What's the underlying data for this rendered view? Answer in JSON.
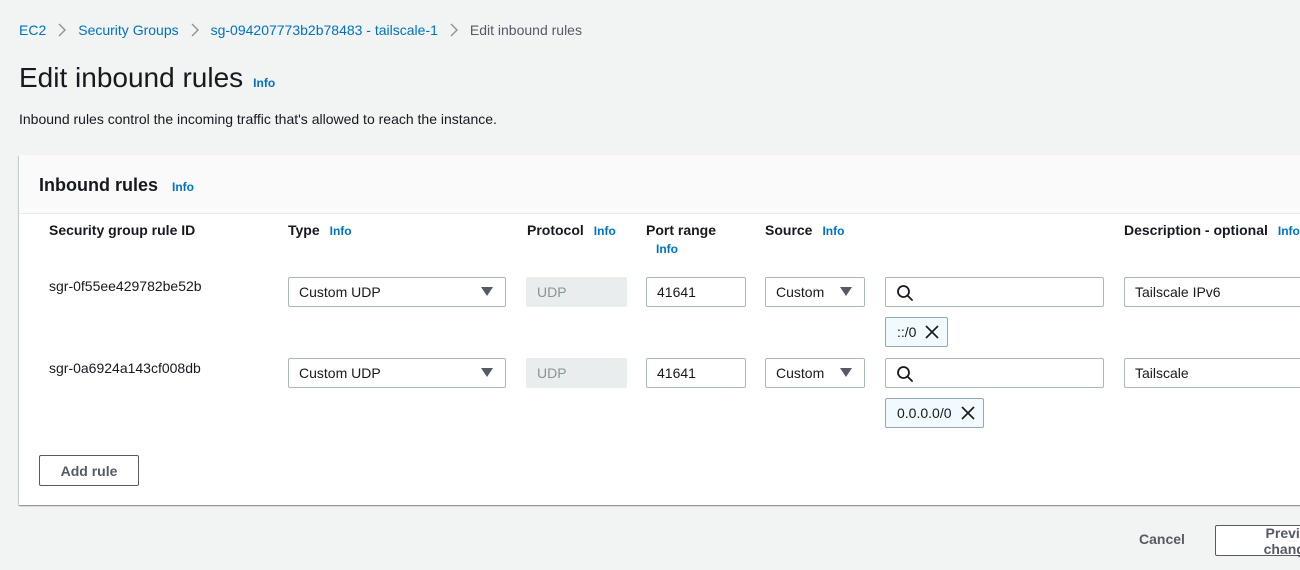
{
  "breadcrumb": {
    "items": [
      {
        "label": "EC2"
      },
      {
        "label": "Security Groups"
      },
      {
        "label": "sg-094207773b2b78483 - tailscale-1"
      },
      {
        "label": "Edit inbound rules"
      }
    ]
  },
  "page": {
    "title": "Edit inbound rules",
    "info": "Info",
    "description": "Inbound rules control the incoming traffic that's allowed to reach the instance."
  },
  "panel": {
    "title": "Inbound rules",
    "info": "Info",
    "columns": {
      "rule_id": "Security group rule ID",
      "type": "Type",
      "protocol": "Protocol",
      "port_range": "Port range",
      "source": "Source",
      "description": "Description - optional",
      "info": "Info"
    },
    "rules": [
      {
        "rule_id": "sgr-0f55ee429782be52b",
        "type": "Custom UDP",
        "protocol": "UDP",
        "port_range": "41641",
        "source_type": "Custom",
        "source_search": "",
        "source_token": "::/0",
        "description": "Tailscale IPv6"
      },
      {
        "rule_id": "sgr-0a6924a143cf008db",
        "type": "Custom UDP",
        "protocol": "UDP",
        "port_range": "41641",
        "source_type": "Custom",
        "source_search": "",
        "source_token": "0.0.0.0/0",
        "description": "Tailscale"
      }
    ],
    "add_rule": "Add rule"
  },
  "footer": {
    "cancel": "Cancel",
    "preview": "Preview changes"
  }
}
